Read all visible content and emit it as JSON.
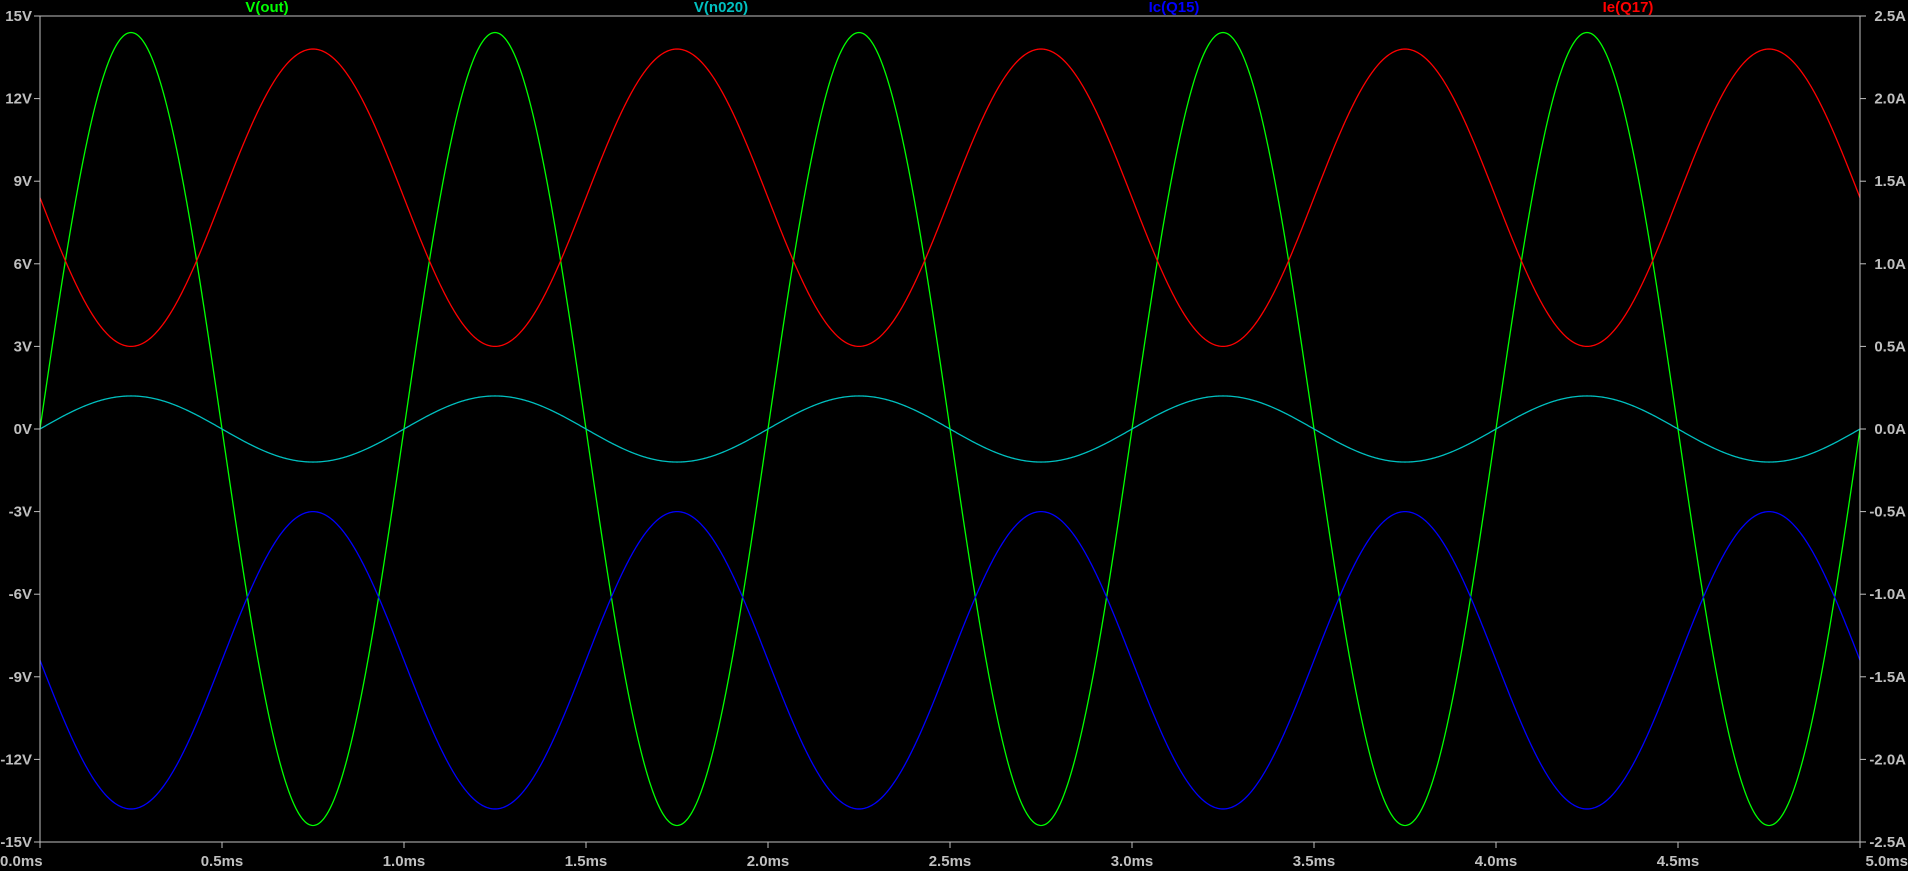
{
  "chart_data": {
    "type": "line",
    "x": {
      "unit": "ms",
      "range": [
        0,
        5
      ],
      "ticks": [
        0,
        0.5,
        1,
        1.5,
        2,
        2.5,
        3,
        3.5,
        4,
        4.5,
        5
      ],
      "tick_labels": [
        "0.0ms",
        "0.5ms",
        "1.0ms",
        "1.5ms",
        "2.0ms",
        "2.5ms",
        "3.0ms",
        "3.5ms",
        "4.0ms",
        "4.5ms",
        "5.0ms"
      ]
    },
    "y_left": {
      "unit": "V",
      "range": [
        -15,
        15
      ],
      "ticks": [
        15,
        12,
        9,
        6,
        3,
        0,
        -3,
        -6,
        -9,
        -12,
        -15
      ],
      "tick_labels": [
        "15V",
        "12V",
        "9V",
        "6V",
        "3V",
        "0V",
        "-3V",
        "-6V",
        "-9V",
        "-12V",
        "-15V"
      ]
    },
    "y_right": {
      "unit": "A",
      "range": [
        -2.5,
        2.5
      ],
      "ticks": [
        2.5,
        2.0,
        1.5,
        1.0,
        0.5,
        0.0,
        -0.5,
        -1.0,
        -1.5,
        -2.0,
        -2.5
      ],
      "tick_labels": [
        "2.5A",
        "2.0A",
        "1.5A",
        "1.0A",
        "0.5A",
        "0.0A",
        "-0.5A",
        "-1.0A",
        "-1.5A",
        "-2.0A",
        "-2.5A"
      ]
    },
    "grid": false,
    "background": "#000000",
    "axis_color": "#c0c0c0",
    "frequency_khz": 1,
    "series": [
      {
        "name": "V(out)",
        "axis": "left",
        "color": "#00ff00",
        "waveform": "sine",
        "offset": 0,
        "amplitude": 14.4,
        "phase_deg": 0
      },
      {
        "name": "V(n020)",
        "axis": "left",
        "color": "#00c0c0",
        "waveform": "sine",
        "offset": 0,
        "amplitude": 1.2,
        "phase_deg": 0
      },
      {
        "name": "Ic(Q15)",
        "axis": "right",
        "color": "#0000ff",
        "waveform": "sine",
        "offset": -1.4,
        "amplitude": 0.9,
        "phase_deg": 180
      },
      {
        "name": "Ie(Q17)",
        "axis": "right",
        "color": "#ff0000",
        "waveform": "sine",
        "offset": 1.4,
        "amplitude": 0.9,
        "phase_deg": 180
      }
    ]
  }
}
